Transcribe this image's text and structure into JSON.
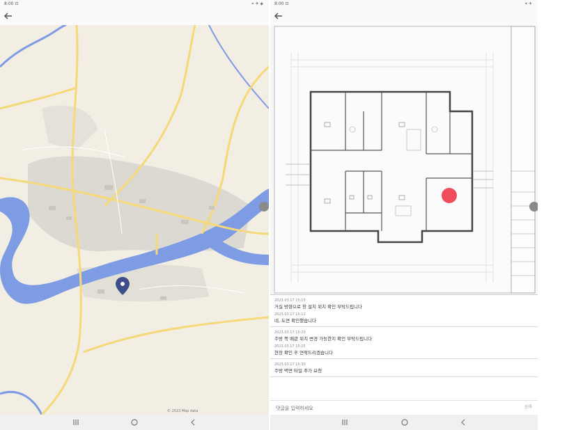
{
  "left_panel": {
    "status": {
      "left": "8:00 ⊡",
      "right": "⌖ ✈ ◈"
    },
    "map": {
      "river_color": "#7e9ce4",
      "land_color": "#f2eee3",
      "road_color": "#f5d979",
      "urban_color": "#dcd9d2",
      "pin_icon": "location-pin-icon"
    },
    "map_footer": "© 2023 Map data"
  },
  "right_panel": {
    "status": {
      "left": "8:00 ⊡",
      "right": "⌖ ✈"
    },
    "drawing": {
      "marker_color": "#ef4d5e"
    },
    "comments": [
      {
        "time": "2023.03.17 15:10",
        "text": "거실 방향으로 창 설치 위치 확인 부탁드립니다"
      },
      {
        "time": "2023.03.17 15:12",
        "text": "네, 도면 확인했습니다"
      },
      {
        "time": "2023.03.17 15:20",
        "text": "주방 쪽 배관 위치 변경 가능한지 확인 부탁드립니다"
      },
      {
        "time": "2023.03.17 15:25",
        "text": "현장 확인 후 연락드리겠습니다"
      },
      {
        "time": "2023.03.17 15:30",
        "text": "주방 벽면 타일 추가 요청"
      }
    ],
    "input": {
      "placeholder": "댓글을 입력하세요",
      "send_label": "등록"
    }
  },
  "nav": {
    "recents_icon": "recents-icon",
    "home_icon": "home-icon",
    "back_icon": "back-chevron-icon"
  }
}
